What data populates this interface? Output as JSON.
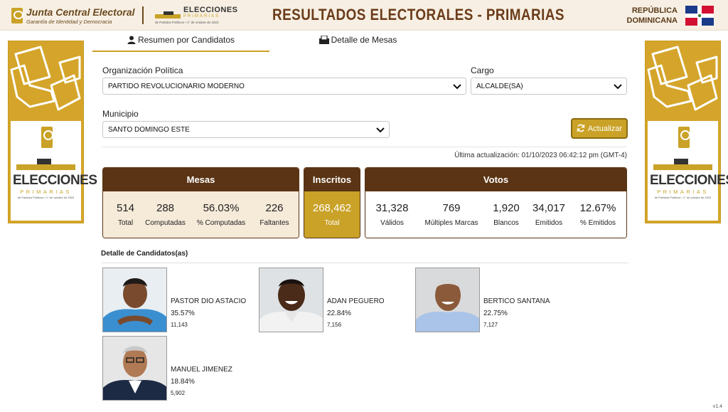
{
  "header": {
    "brand_title": "Junta Central Electoral",
    "brand_subtitle": "Garantía de Identidad y Democracia",
    "logo_title": "ELECCIONES",
    "logo_subtitle": "PRIMARIAS",
    "logo_footer": "de Partidos Políticos • 1° de octubre de 2023",
    "page_title": "RESULTADOS ELECTORALES - PRIMARIAS",
    "country_line1": "REPÚBLICA",
    "country_line2": "DOMINICANA"
  },
  "banner": {
    "title": "ELECCIONES",
    "subtitle": "PRIMARIAS",
    "footer": "de Partidos Políticos • 1° de octubre de 2023",
    "logo_text": "JCE"
  },
  "tabs": [
    {
      "label": "Resumen por Candidatos",
      "active": true
    },
    {
      "label": "Detalle de Mesas",
      "active": false
    }
  ],
  "filters": {
    "org_label": "Organización Política",
    "org_value": "PARTIDO REVOLUCIONARIO MODERNO",
    "cargo_label": "Cargo",
    "cargo_value": "ALCALDE(SA)",
    "municipio_label": "Municipio",
    "municipio_value": "SANTO DOMINGO ESTE",
    "update_button": "Actualizar"
  },
  "last_update": "Última actualización: 01/10/2023 06:42:12 pm (GMT-4)",
  "mesas": {
    "title": "Mesas",
    "items": [
      {
        "value": "514",
        "label": "Total"
      },
      {
        "value": "288",
        "label": "Computadas"
      },
      {
        "value": "56.03%",
        "label": "% Computadas"
      },
      {
        "value": "226",
        "label": "Faltantes"
      }
    ]
  },
  "inscritos": {
    "title": "Inscritos",
    "value": "268,462",
    "label": "Total"
  },
  "votos": {
    "title": "Votos",
    "items": [
      {
        "value": "31,328",
        "label": "Válidos"
      },
      {
        "value": "769",
        "label": "Múltiples Marcas"
      },
      {
        "value": "1,920",
        "label": "Blancos"
      },
      {
        "value": "34,017",
        "label": "Emitidos"
      },
      {
        "value": "12.67%",
        "label": "% Emitidos"
      }
    ]
  },
  "candidates_title": "Detalle de Candidatos(as)",
  "candidates": [
    {
      "name": "PASTOR DIO ASTACIO",
      "percent": "35.57%",
      "votes": "11,143"
    },
    {
      "name": "ADAN PEGUERO",
      "percent": "22.84%",
      "votes": "7,156"
    },
    {
      "name": "BERTICO SANTANA",
      "percent": "22.75%",
      "votes": "7,127"
    },
    {
      "name": "MANUEL JIMENEZ",
      "percent": "18.84%",
      "votes": "5,902"
    }
  ],
  "version": "v1.4",
  "colors": {
    "gold": "#c9a227",
    "brown": "#5a3414",
    "cream": "#f6ead9"
  }
}
